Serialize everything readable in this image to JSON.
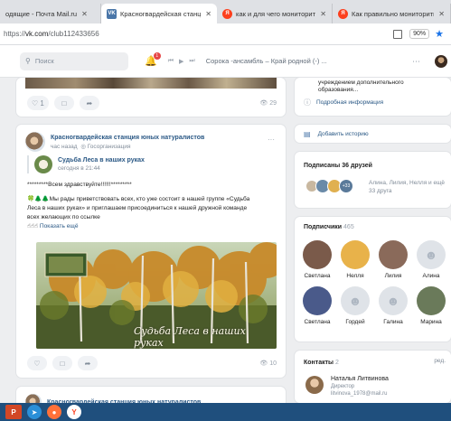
{
  "browser": {
    "tabs": [
      {
        "label": "одящие - Почта Mail.ru",
        "close": "✕",
        "active": false,
        "favicon": "",
        "favicon_color": "#dfe1e5"
      },
      {
        "label": "Красногвардейская станци",
        "close": "✕",
        "active": true,
        "favicon": "VK",
        "favicon_color": "#4a76a8"
      },
      {
        "label": "как и для чего мониторить с",
        "close": "✕",
        "active": false,
        "favicon": "Я",
        "favicon_color": "#fc3f1d"
      },
      {
        "label": "Как правильно мониторить с",
        "close": "✕",
        "active": false,
        "favicon": "Я",
        "favicon_color": "#fc3f1d"
      }
    ],
    "url_prefix": "https://",
    "url_host": "vk.com",
    "url_path": "/club112433656",
    "zoom": "90%"
  },
  "vk_header": {
    "search_placeholder": "Поиск",
    "notifications_count": "1",
    "now_playing": "Сорока -ансамбль – Край родной (-) ..."
  },
  "top_post": {
    "likes": "1",
    "views": "29"
  },
  "post": {
    "author": "Красногвардейская станция юных натуралистов",
    "time": "час назад",
    "privacy": "Госорганизация",
    "more": "···",
    "repost_author": "Судьба Леса в наших руках",
    "repost_time": "сегодня в 21:44",
    "text_line1": "*********Всем здравствуйте!!!!!!*********",
    "text_line2": "🍀🌲🌲Мы рады приветствовать всех, кто уже состоит в нашей группе «Судьба",
    "text_line3": "Леса в наших руках» и приглашаем присоединиться к нашей дружной команде",
    "text_line4": "всех желающих по ссылке",
    "show_more": "Показать ещё",
    "photo_caption": "Судьба Леса в наших руках",
    "views": "10"
  },
  "next_post": {
    "author": "Красногвардейская станция юных натуралистов"
  },
  "info_panel": {
    "line1": "учреждением дополнительного",
    "line2": "образования...",
    "details_link": "Подробная информация"
  },
  "add_story": "Добавить историю",
  "friends": {
    "title": "Подписаны 36 друзей",
    "names": "Алина, Лилия, Нелля и ещё",
    "count_line": "33 друга",
    "badge": "+33"
  },
  "subscribers": {
    "title": "Подписчики",
    "count": "465",
    "people": [
      {
        "name": "Светлана",
        "color": "#7a5a4a"
      },
      {
        "name": "Нелля",
        "color": "#e8b24a"
      },
      {
        "name": "Лилия",
        "color": "#8a6a5a"
      },
      {
        "name": "Алина",
        "color": "#dfe3e8"
      },
      {
        "name": "Светлана",
        "color": "#4a5a8a"
      },
      {
        "name": "Гордей",
        "color": "#dfe3e8"
      },
      {
        "name": "Галина",
        "color": "#dfe3e8"
      },
      {
        "name": "Марина",
        "color": "#6a7a5a"
      }
    ]
  },
  "contacts": {
    "title": "Контакты",
    "count": "2",
    "edit": "ред.",
    "name": "Наталья Литвинова",
    "role": "Директор",
    "email": "litvinova_1978@mail.ru"
  },
  "colors": {
    "vk_blue": "#4a76a8",
    "link": "#2a5885",
    "bg": "#edeef0",
    "taskbar": "#1f4f7d"
  }
}
